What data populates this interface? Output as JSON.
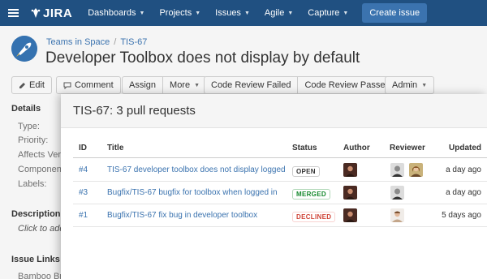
{
  "nav": {
    "logo_text": "JIRA",
    "items": [
      {
        "label": "Dashboards"
      },
      {
        "label": "Projects"
      },
      {
        "label": "Issues"
      },
      {
        "label": "Agile"
      },
      {
        "label": "Capture"
      }
    ],
    "create_label": "Create issue",
    "bar_color": "#205081"
  },
  "issue": {
    "breadcrumb": [
      "Teams in Space",
      "TIS-67"
    ],
    "title": "Developer Toolbox does not display by default"
  },
  "toolbar": {
    "edit_label": "Edit",
    "comment_label": "Comment",
    "assign_label": "Assign",
    "more_label": "More",
    "code_review_failed": "Code Review Failed",
    "code_review_passed": "Code Review Passed",
    "admin_label": "Admin"
  },
  "details": {
    "heading": "Details",
    "fields": [
      "Type:",
      "Priority:",
      "Affects Vers",
      "Componen",
      "Labels:"
    ],
    "description_heading": "Description",
    "description_placeholder": "Click to add",
    "issue_links_heading": "Issue Links",
    "issue_links_item": "Bamboo Bra"
  },
  "dialog": {
    "title": "TIS-67: 3 pull requests",
    "columns": {
      "id": "ID",
      "title": "Title",
      "status": "Status",
      "author": "Author",
      "reviewer": "Reviewer",
      "updated": "Updated"
    },
    "rows": [
      {
        "id": "#4",
        "title": "TIS-67 developer toolbox does not display logged",
        "status": "OPEN",
        "updated": "a day ago"
      },
      {
        "id": "#3",
        "title": "Bugfix/TIS-67 bugfix for toolbox when logged in",
        "status": "MERGED",
        "updated": "a day ago"
      },
      {
        "id": "#1",
        "title": "Bugfix/TIS-67 fix bug in developer toolbox",
        "status": "DECLINED",
        "updated": "5 days ago"
      }
    ]
  }
}
